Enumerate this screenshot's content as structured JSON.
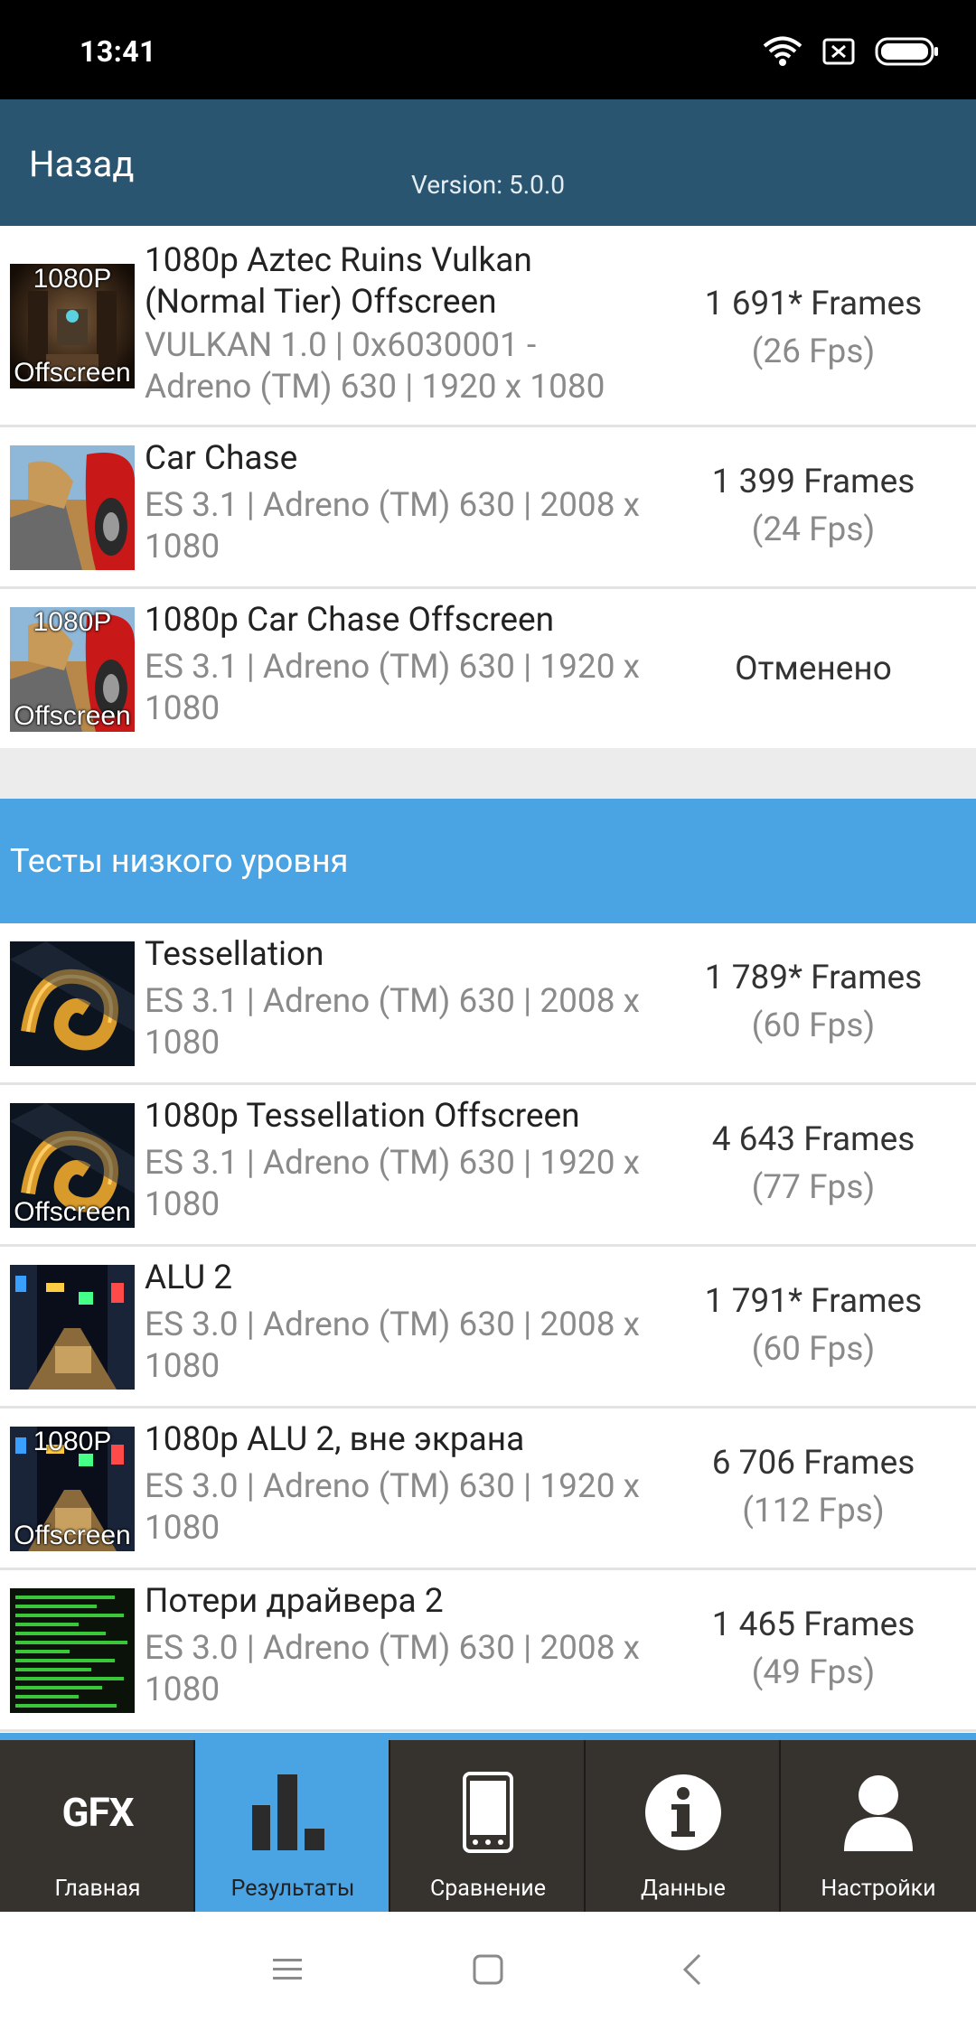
{
  "status_bar": {
    "time": "13:41"
  },
  "app_bar": {
    "back_label": "Назад",
    "version": "Version: 5.0.0"
  },
  "tests_top": [
    {
      "title": "1080p Aztec Ruins Vulkan (Normal Tier) Offscreen",
      "subtitle": "VULKAN 1.0 | 0x6030001 - Adreno (TM) 630 | 1920 x 1080",
      "frames": "1 691* Frames",
      "fps": "(26 Fps)",
      "thumb_icon": "aztec-ruins-thumbnail",
      "thumb_top": "1080P",
      "thumb_bottom": "Offscreen"
    },
    {
      "title": "Car Chase",
      "subtitle": "ES 3.1 | Adreno (TM) 630 | 2008 x 1080",
      "frames": "1 399 Frames",
      "fps": "(24 Fps)",
      "thumb_icon": "car-chase-thumbnail",
      "thumb_top": "",
      "thumb_bottom": ""
    },
    {
      "title": "1080p Car Chase Offscreen",
      "subtitle": "ES 3.1 | Adreno (TM) 630 | 1920 x 1080",
      "status": "Отменено",
      "thumb_icon": "car-chase-thumbnail",
      "thumb_top": "1080P",
      "thumb_bottom": "Offscreen"
    }
  ],
  "section_low_level": {
    "label": "Тесты низкого уровня"
  },
  "tests_low": [
    {
      "title": "Tessellation",
      "subtitle": "ES 3.1 | Adreno (TM) 630 | 2008 x 1080",
      "frames": "1 789* Frames",
      "fps": "(60 Fps)",
      "thumb_icon": "tessellation-thumbnail",
      "thumb_top": "",
      "thumb_bottom": ""
    },
    {
      "title": "1080p Tessellation Offscreen",
      "subtitle": "ES 3.1 | Adreno (TM) 630 | 1920 x 1080",
      "frames": "4 643 Frames",
      "fps": "(77 Fps)",
      "thumb_icon": "tessellation-thumbnail",
      "thumb_top": "",
      "thumb_bottom": "Offscreen"
    },
    {
      "title": "ALU 2",
      "subtitle": "ES 3.0 | Adreno (TM) 630 | 2008 x 1080",
      "frames": "1 791* Frames",
      "fps": "(60 Fps)",
      "thumb_icon": "alu-thumbnail",
      "thumb_top": "",
      "thumb_bottom": ""
    },
    {
      "title": "1080p ALU 2, вне экрана",
      "subtitle": "ES 3.0 | Adreno (TM) 630 | 1920 x 1080",
      "frames": "6 706 Frames",
      "fps": "(112 Fps)",
      "thumb_icon": "alu-thumbnail",
      "thumb_top": "1080P",
      "thumb_bottom": "Offscreen"
    },
    {
      "title": "Потери драйвера 2",
      "subtitle": "ES 3.0 | Adreno (TM) 630 | 2008 x 1080",
      "frames": "1 465 Frames",
      "fps": "(49 Fps)",
      "thumb_icon": "driver-overhead-thumbnail",
      "thumb_top": "",
      "thumb_bottom": ""
    }
  ],
  "tab_bar": {
    "logo_text": "GFX",
    "tabs": [
      {
        "label": "Главная",
        "icon": "gfx-logo-icon",
        "active": false
      },
      {
        "label": "Результаты",
        "icon": "bar-chart-icon",
        "active": true
      },
      {
        "label": "Сравнение",
        "icon": "phone-icon",
        "active": false
      },
      {
        "label": "Данные",
        "icon": "info-icon",
        "active": false
      },
      {
        "label": "Настройки",
        "icon": "user-icon",
        "active": false
      }
    ]
  },
  "nav_bar": {
    "buttons": [
      "menu-icon",
      "home-icon",
      "back-icon"
    ]
  },
  "colors": {
    "app_bar": "#2a5571",
    "accent": "#4aa3e3",
    "tab_bar": "#36322e",
    "status_bar": "#000000"
  }
}
